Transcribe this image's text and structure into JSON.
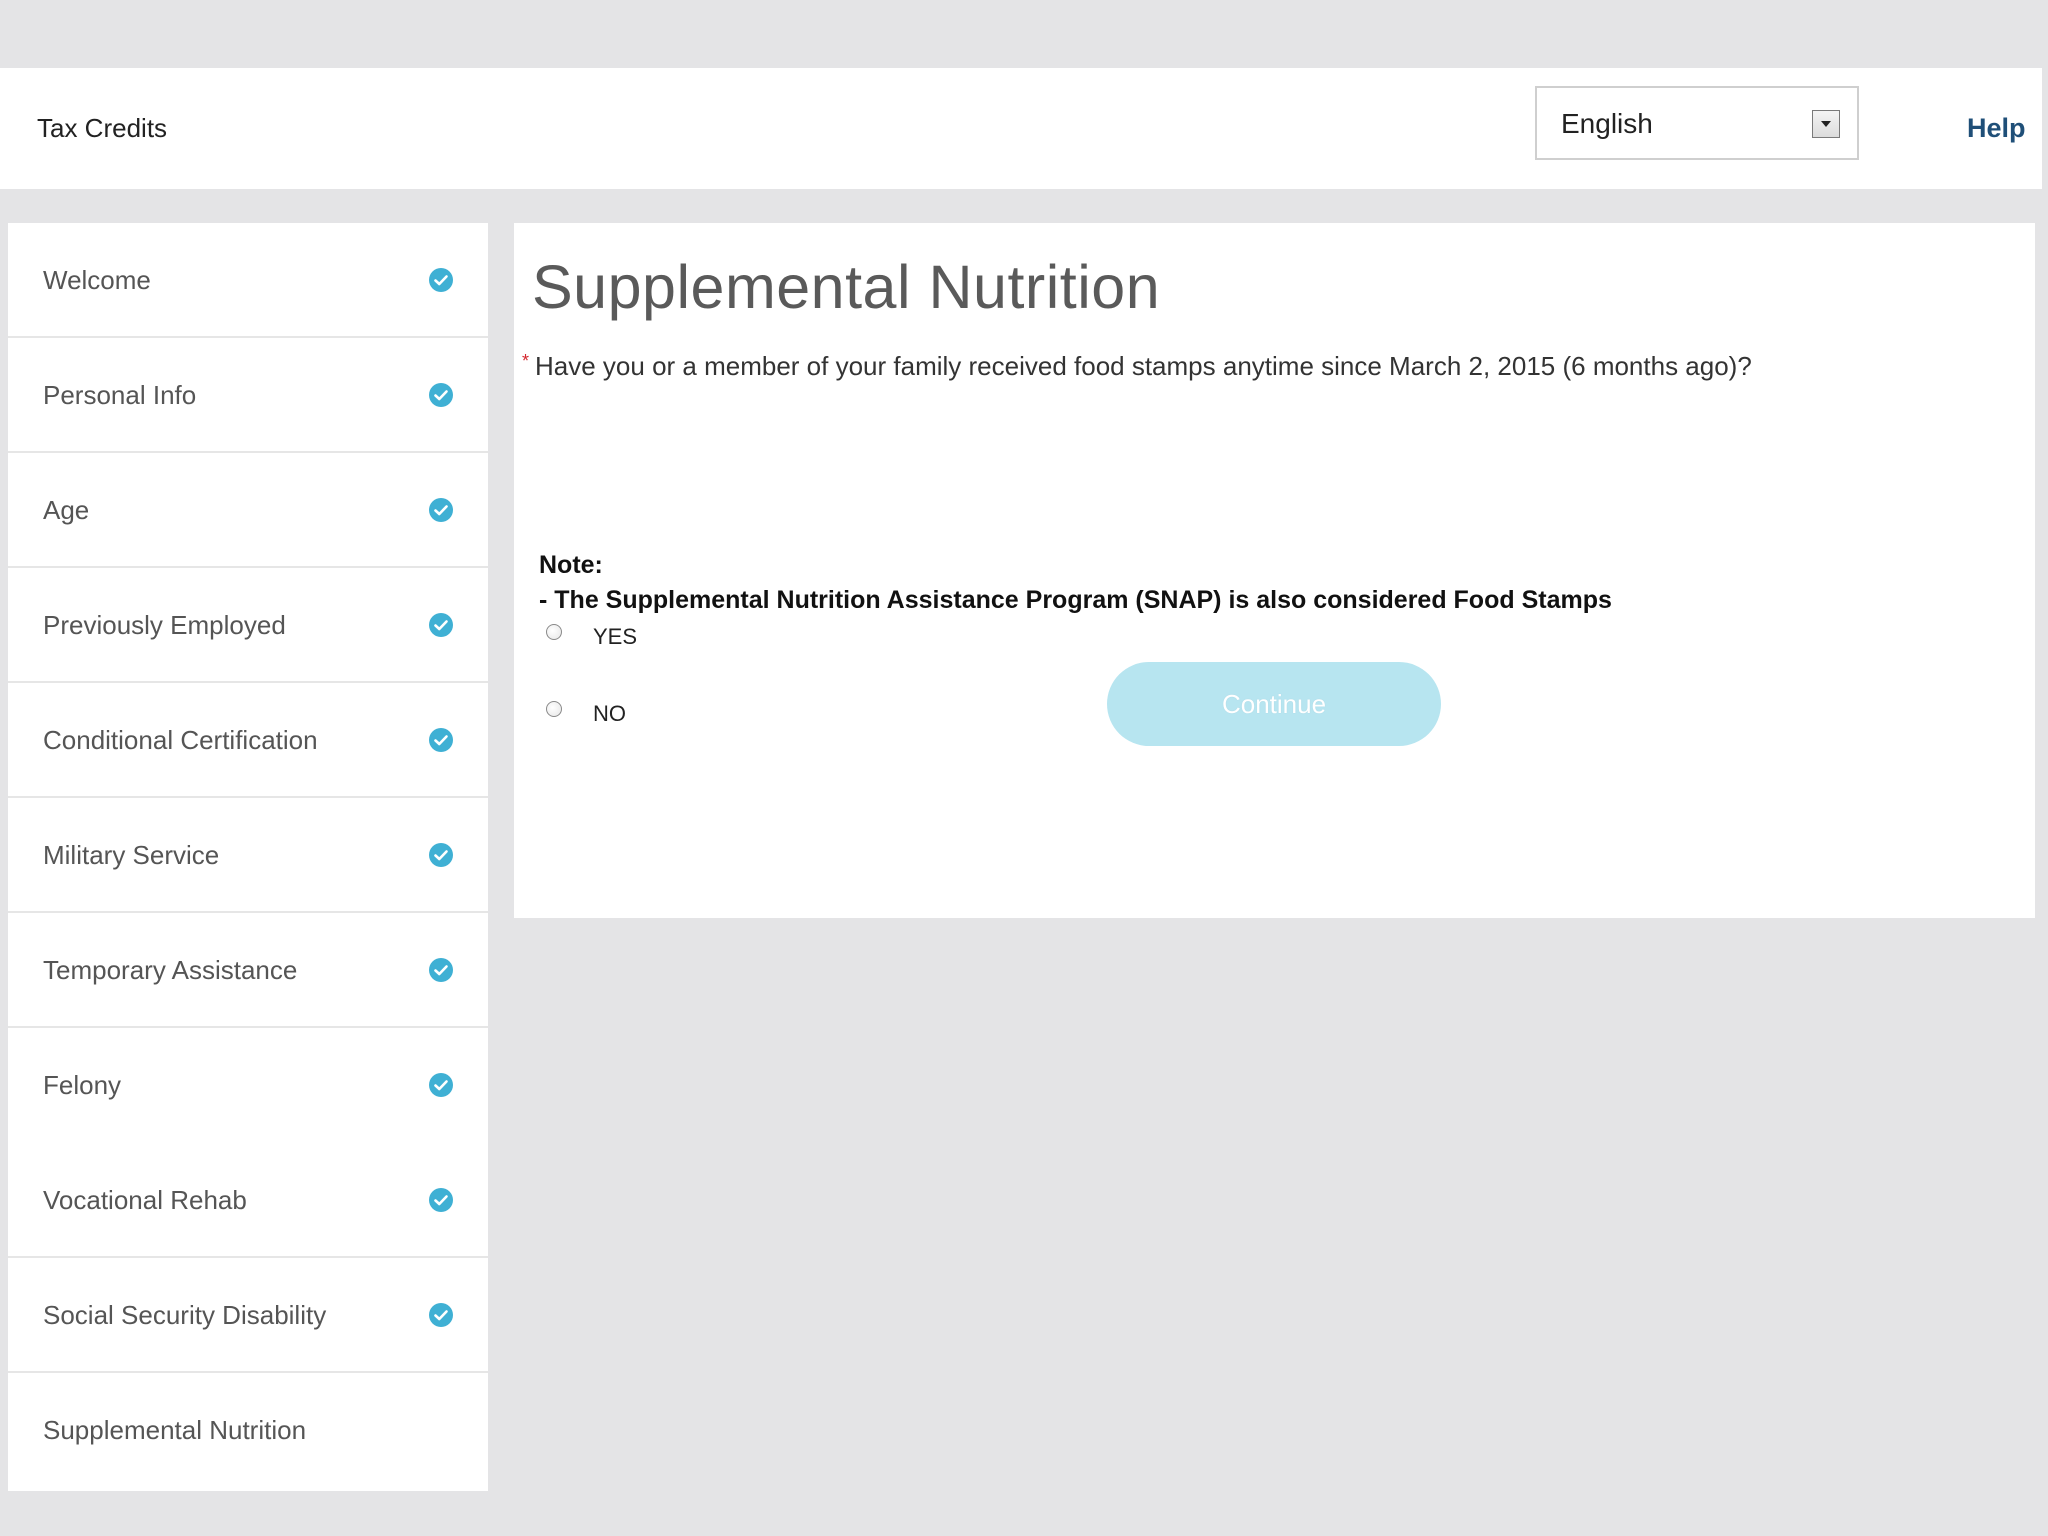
{
  "header": {
    "title": "Tax Credits",
    "language": {
      "selected": "English"
    },
    "help_label": "Help"
  },
  "sidebar": {
    "items": [
      {
        "label": "Welcome",
        "completed": true
      },
      {
        "label": "Personal Info",
        "completed": true
      },
      {
        "label": "Age",
        "completed": true
      },
      {
        "label": "Previously Employed",
        "completed": true
      },
      {
        "label": "Conditional Certification",
        "completed": true
      },
      {
        "label": "Military Service",
        "completed": true
      },
      {
        "label": "Temporary Assistance",
        "completed": true
      },
      {
        "label": "Felony",
        "completed": true
      },
      {
        "label": "Vocational Rehab",
        "completed": true
      },
      {
        "label": "Social Security Disability",
        "completed": true
      },
      {
        "label": "Supplemental Nutrition",
        "completed": false
      }
    ]
  },
  "main": {
    "title": "Supplemental Nutrition",
    "question": {
      "required_marker": "*",
      "text": "Have you or a member of your family received food stamps anytime since March 2, 2015 (6 months ago)?",
      "options": [
        {
          "label": "YES",
          "selected": false
        },
        {
          "label": "NO",
          "selected": false
        }
      ]
    },
    "note": {
      "heading": "Note:",
      "text": "- The Supplemental Nutrition Assistance Program (SNAP) is also considered Food Stamps"
    },
    "continue_label": "Continue"
  },
  "colors": {
    "background": "#e4e4e6",
    "panel": "#ffffff",
    "check_icon": "#3fb0d4",
    "help_link": "#1f4f78",
    "continue_disabled": "#b7e5f0",
    "required": "#d4262d"
  },
  "icons": {
    "completed": "check-circle-icon",
    "dropdown": "chevron-down-icon",
    "radio": "radio-icon"
  }
}
